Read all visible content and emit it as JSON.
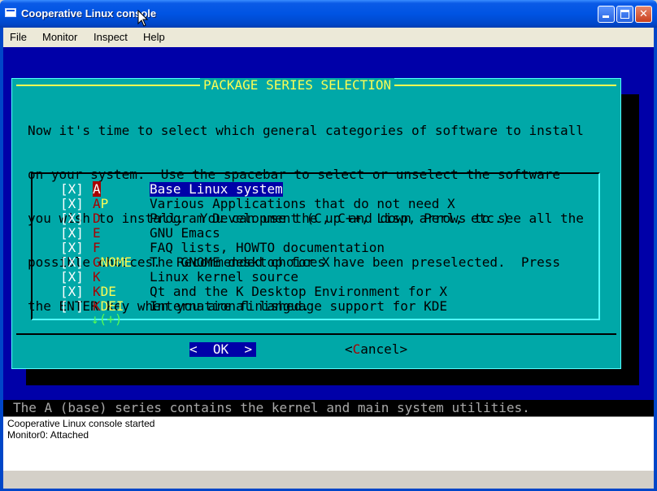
{
  "window": {
    "title": "Cooperative Linux console",
    "icon": "console-window-icon",
    "controls": [
      "minimize",
      "maximize",
      "close"
    ]
  },
  "menu": [
    "File",
    "Monitor",
    "Inspect",
    "Help"
  ],
  "dialog": {
    "title": "PACKAGE SERIES SELECTION",
    "description_lines": [
      "Now it's time to select which general categories of software to install",
      "on your system.  Use the spacebar to select or unselect the software",
      "you wish to install.  You can use the up and down arrows to see all the",
      "possible choices.  Recommended choices have been preselected.  Press",
      "the ENTER key when you are finished."
    ],
    "items": [
      {
        "check": "[X]",
        "hot": "A",
        "rest": "",
        "desc": "Base Linux system",
        "selected": true
      },
      {
        "check": "[X]",
        "hot": "A",
        "rest": "P",
        "desc": "Various Applications that do not need X"
      },
      {
        "check": "[X]",
        "hot": "D",
        "rest": "",
        "desc": "Program Development (C, C++, Lisp, Perl, etc.)"
      },
      {
        "check": "[X]",
        "hot": "E",
        "rest": "",
        "desc": "GNU Emacs"
      },
      {
        "check": "[X]",
        "hot": "F",
        "rest": "",
        "desc": "FAQ lists, HOWTO documentation"
      },
      {
        "check": "[X]",
        "hot": "G",
        "rest": "NOME",
        "desc": "The GNOME desktop for X"
      },
      {
        "check": "[X]",
        "hot": "K",
        "rest": "",
        "desc": "Linux kernel source"
      },
      {
        "check": "[X]",
        "hot": "K",
        "rest": "DE",
        "desc": "Qt and the K Desktop Environment for X"
      },
      {
        "check": "[ ]",
        "hot": "K",
        "rest": "DEI",
        "desc": "International language support for KDE"
      }
    ],
    "more_indicator": "↓(+)",
    "ok": {
      "left": "<",
      "hot": "O",
      "rest": "K",
      "right": ">"
    },
    "cancel": {
      "left": "<",
      "hot": "C",
      "rest": "ancel",
      "right": ">"
    }
  },
  "status_line": "The A (base) series contains the kernel and main system utilities.",
  "log": [
    "Cooperative Linux console started",
    "Monitor0: Attached"
  ],
  "colors": {
    "console_bg": "#0000a8",
    "dialog_bg": "#00a8a8",
    "title": "#fcfc54",
    "hotkey": "#a80000"
  }
}
